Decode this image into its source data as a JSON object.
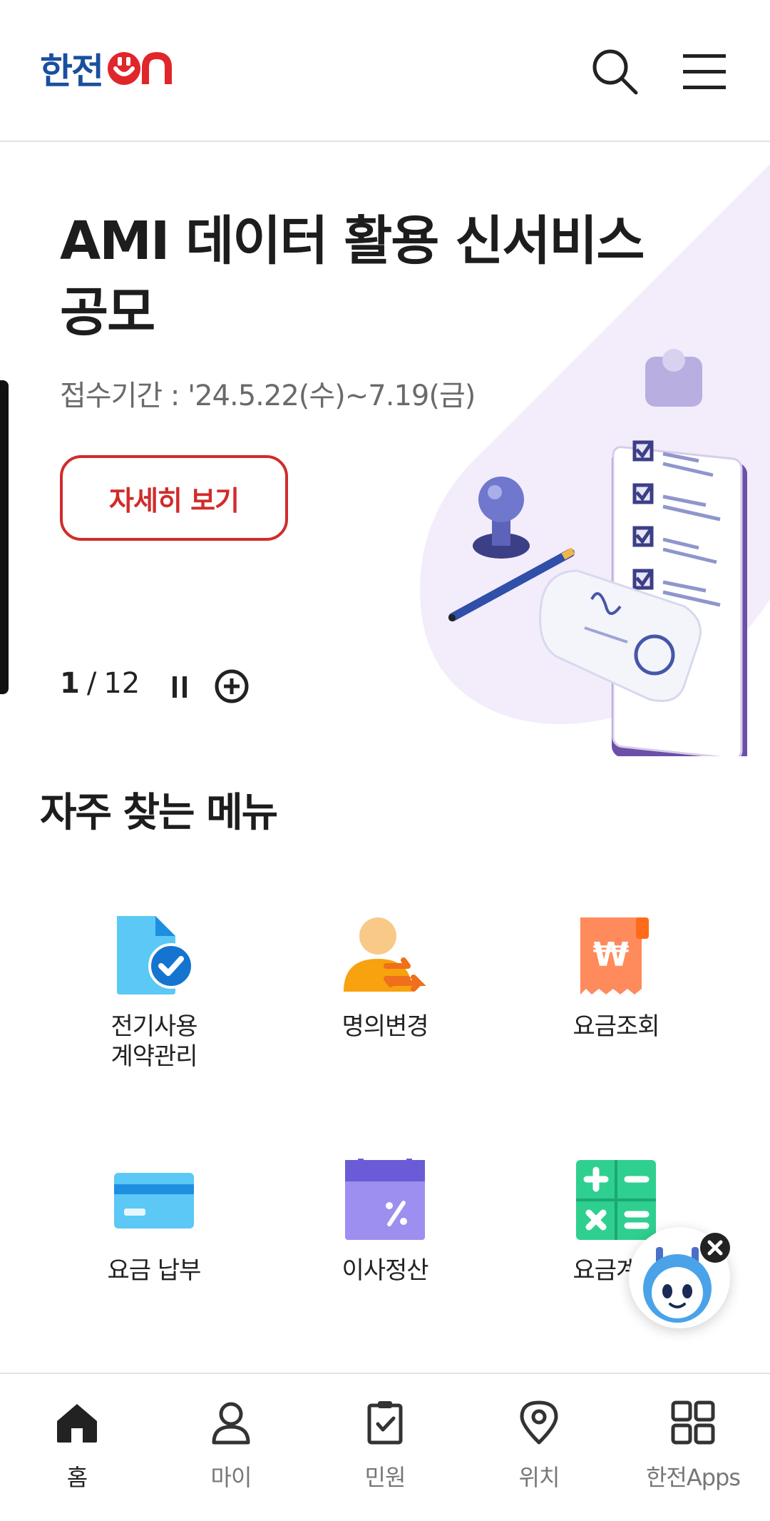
{
  "header": {
    "logo_main": "한전",
    "logo_on": "ON",
    "search_icon": "search-icon",
    "menu_icon": "hamburger-menu-icon"
  },
  "hero": {
    "title": "AMI 데이터 활용 신서비스 공모",
    "period": "접수기간 : '24.5.22(수)~7.19(금)",
    "button_label": "자세히 보기",
    "pager_current": "1",
    "pager_sep": "/",
    "pager_total": "12",
    "pause_icon": "pause-icon",
    "plus_icon": "plus-circle-icon",
    "illustration": "clipboard-stamp-pen-illustration"
  },
  "frequent": {
    "title": "자주 찾는 메뉴",
    "items": [
      {
        "label": "전기사용\n계약관리",
        "icon": "document-check-icon"
      },
      {
        "label": "명의변경",
        "icon": "person-transfer-icon"
      },
      {
        "label": "요금조회",
        "icon": "won-receipt-icon"
      },
      {
        "label": "요금 납부",
        "icon": "credit-card-icon"
      },
      {
        "label": "이사정산",
        "icon": "calendar-percent-icon"
      },
      {
        "label": "요금계산",
        "icon": "calculator-icon"
      }
    ]
  },
  "chatbot": {
    "icon": "chatbot-robot-icon",
    "close_icon": "close-icon"
  },
  "bottom_nav": [
    {
      "label": "홈",
      "icon": "home-icon"
    },
    {
      "label": "마이",
      "icon": "person-icon"
    },
    {
      "label": "민원",
      "icon": "clipboard-check-icon"
    },
    {
      "label": "위치",
      "icon": "location-pin-icon"
    },
    {
      "label": "한전Apps",
      "icon": "grid-apps-icon"
    }
  ],
  "colors": {
    "brand_blue": "#1a4fa0",
    "brand_red": "#e0262b",
    "accent_red": "#d22b2b",
    "hero_bg": "#f3ecfb"
  }
}
